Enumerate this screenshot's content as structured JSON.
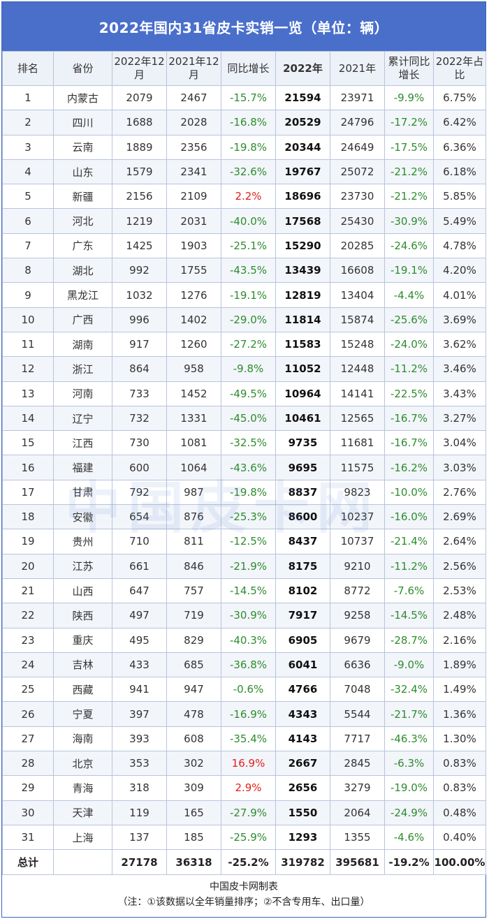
{
  "title": "2022年国内31省皮卡实销一览（单位：辆）",
  "headers": {
    "rank": "排名",
    "province": "省份",
    "dec2022": "2022年12月",
    "dec2021": "2021年12月",
    "yoy": "同比增长",
    "y2022": "2022年",
    "y2021": "2021年",
    "cum_yoy": "累计同比增长",
    "share": "2022年占比"
  },
  "colors": {
    "header_bg": "#4a6fcb",
    "positive": "#e0201c",
    "negative": "#2e8b2e"
  },
  "rows": [
    {
      "rank": "1",
      "province": "内蒙古",
      "dec2022": "2079",
      "dec2021": "2467",
      "yoy": "-15.7%",
      "y2022": "21594",
      "y2021": "23971",
      "cum_yoy": "-9.9%",
      "share": "6.75%"
    },
    {
      "rank": "2",
      "province": "四川",
      "dec2022": "1688",
      "dec2021": "2028",
      "yoy": "-16.8%",
      "y2022": "20529",
      "y2021": "24796",
      "cum_yoy": "-17.2%",
      "share": "6.42%"
    },
    {
      "rank": "3",
      "province": "云南",
      "dec2022": "1889",
      "dec2021": "2356",
      "yoy": "-19.8%",
      "y2022": "20344",
      "y2021": "24649",
      "cum_yoy": "-17.5%",
      "share": "6.36%"
    },
    {
      "rank": "4",
      "province": "山东",
      "dec2022": "1579",
      "dec2021": "2341",
      "yoy": "-32.6%",
      "y2022": "19767",
      "y2021": "25072",
      "cum_yoy": "-21.2%",
      "share": "6.18%"
    },
    {
      "rank": "5",
      "province": "新疆",
      "dec2022": "2156",
      "dec2021": "2109",
      "yoy": "2.2%",
      "y2022": "18696",
      "y2021": "23730",
      "cum_yoy": "-21.2%",
      "share": "5.85%"
    },
    {
      "rank": "6",
      "province": "河北",
      "dec2022": "1219",
      "dec2021": "2031",
      "yoy": "-40.0%",
      "y2022": "17568",
      "y2021": "25430",
      "cum_yoy": "-30.9%",
      "share": "5.49%"
    },
    {
      "rank": "7",
      "province": "广东",
      "dec2022": "1425",
      "dec2021": "1903",
      "yoy": "-25.1%",
      "y2022": "15290",
      "y2021": "20285",
      "cum_yoy": "-24.6%",
      "share": "4.78%"
    },
    {
      "rank": "8",
      "province": "湖北",
      "dec2022": "992",
      "dec2021": "1755",
      "yoy": "-43.5%",
      "y2022": "13439",
      "y2021": "16608",
      "cum_yoy": "-19.1%",
      "share": "4.20%"
    },
    {
      "rank": "9",
      "province": "黑龙江",
      "dec2022": "1032",
      "dec2021": "1276",
      "yoy": "-19.1%",
      "y2022": "12819",
      "y2021": "13404",
      "cum_yoy": "-4.4%",
      "share": "4.01%"
    },
    {
      "rank": "10",
      "province": "广西",
      "dec2022": "996",
      "dec2021": "1402",
      "yoy": "-29.0%",
      "y2022": "11814",
      "y2021": "15874",
      "cum_yoy": "-25.6%",
      "share": "3.69%"
    },
    {
      "rank": "11",
      "province": "湖南",
      "dec2022": "917",
      "dec2021": "1260",
      "yoy": "-27.2%",
      "y2022": "11583",
      "y2021": "15248",
      "cum_yoy": "-24.0%",
      "share": "3.62%"
    },
    {
      "rank": "12",
      "province": "浙江",
      "dec2022": "864",
      "dec2021": "958",
      "yoy": "-9.8%",
      "y2022": "11052",
      "y2021": "12448",
      "cum_yoy": "-11.2%",
      "share": "3.46%"
    },
    {
      "rank": "13",
      "province": "河南",
      "dec2022": "733",
      "dec2021": "1452",
      "yoy": "-49.5%",
      "y2022": "10964",
      "y2021": "14141",
      "cum_yoy": "-22.5%",
      "share": "3.43%"
    },
    {
      "rank": "14",
      "province": "辽宁",
      "dec2022": "732",
      "dec2021": "1331",
      "yoy": "-45.0%",
      "y2022": "10461",
      "y2021": "12565",
      "cum_yoy": "-16.7%",
      "share": "3.27%"
    },
    {
      "rank": "15",
      "province": "江西",
      "dec2022": "730",
      "dec2021": "1081",
      "yoy": "-32.5%",
      "y2022": "9735",
      "y2021": "11681",
      "cum_yoy": "-16.7%",
      "share": "3.04%"
    },
    {
      "rank": "16",
      "province": "福建",
      "dec2022": "600",
      "dec2021": "1064",
      "yoy": "-43.6%",
      "y2022": "9695",
      "y2021": "11575",
      "cum_yoy": "-16.2%",
      "share": "3.03%"
    },
    {
      "rank": "17",
      "province": "甘肃",
      "dec2022": "792",
      "dec2021": "987",
      "yoy": "-19.8%",
      "y2022": "8837",
      "y2021": "9823",
      "cum_yoy": "-10.0%",
      "share": "2.76%"
    },
    {
      "rank": "18",
      "province": "安徽",
      "dec2022": "654",
      "dec2021": "876",
      "yoy": "-25.3%",
      "y2022": "8600",
      "y2021": "10237",
      "cum_yoy": "-16.0%",
      "share": "2.69%"
    },
    {
      "rank": "19",
      "province": "贵州",
      "dec2022": "710",
      "dec2021": "811",
      "yoy": "-12.5%",
      "y2022": "8437",
      "y2021": "10737",
      "cum_yoy": "-21.4%",
      "share": "2.64%"
    },
    {
      "rank": "20",
      "province": "江苏",
      "dec2022": "661",
      "dec2021": "846",
      "yoy": "-21.9%",
      "y2022": "8175",
      "y2021": "9210",
      "cum_yoy": "-11.2%",
      "share": "2.56%"
    },
    {
      "rank": "21",
      "province": "山西",
      "dec2022": "647",
      "dec2021": "757",
      "yoy": "-14.5%",
      "y2022": "8102",
      "y2021": "8772",
      "cum_yoy": "-7.6%",
      "share": "2.53%"
    },
    {
      "rank": "22",
      "province": "陕西",
      "dec2022": "497",
      "dec2021": "719",
      "yoy": "-30.9%",
      "y2022": "7917",
      "y2021": "9258",
      "cum_yoy": "-14.5%",
      "share": "2.48%"
    },
    {
      "rank": "23",
      "province": "重庆",
      "dec2022": "495",
      "dec2021": "829",
      "yoy": "-40.3%",
      "y2022": "6905",
      "y2021": "9679",
      "cum_yoy": "-28.7%",
      "share": "2.16%"
    },
    {
      "rank": "24",
      "province": "吉林",
      "dec2022": "433",
      "dec2021": "685",
      "yoy": "-36.8%",
      "y2022": "6041",
      "y2021": "6636",
      "cum_yoy": "-9.0%",
      "share": "1.89%"
    },
    {
      "rank": "25",
      "province": "西藏",
      "dec2022": "941",
      "dec2021": "947",
      "yoy": "-0.6%",
      "y2022": "4766",
      "y2021": "7048",
      "cum_yoy": "-32.4%",
      "share": "1.49%"
    },
    {
      "rank": "26",
      "province": "宁夏",
      "dec2022": "397",
      "dec2021": "478",
      "yoy": "-16.9%",
      "y2022": "4343",
      "y2021": "5544",
      "cum_yoy": "-21.7%",
      "share": "1.36%"
    },
    {
      "rank": "27",
      "province": "海南",
      "dec2022": "393",
      "dec2021": "608",
      "yoy": "-35.4%",
      "y2022": "4143",
      "y2021": "7717",
      "cum_yoy": "-46.3%",
      "share": "1.30%"
    },
    {
      "rank": "28",
      "province": "北京",
      "dec2022": "353",
      "dec2021": "302",
      "yoy": "16.9%",
      "y2022": "2667",
      "y2021": "2845",
      "cum_yoy": "-6.3%",
      "share": "0.83%"
    },
    {
      "rank": "29",
      "province": "青海",
      "dec2022": "318",
      "dec2021": "309",
      "yoy": "2.9%",
      "y2022": "2656",
      "y2021": "3279",
      "cum_yoy": "-19.0%",
      "share": "0.83%"
    },
    {
      "rank": "30",
      "province": "天津",
      "dec2022": "119",
      "dec2021": "165",
      "yoy": "-27.9%",
      "y2022": "1550",
      "y2021": "2064",
      "cum_yoy": "-24.9%",
      "share": "0.48%"
    },
    {
      "rank": "31",
      "province": "上海",
      "dec2022": "137",
      "dec2021": "185",
      "yoy": "-25.9%",
      "y2022": "1293",
      "y2021": "1355",
      "cum_yoy": "-4.6%",
      "share": "0.40%"
    }
  ],
  "total": {
    "label": "总计",
    "dec2022": "27178",
    "dec2021": "36318",
    "yoy": "-25.2%",
    "y2022": "319782",
    "y2021": "395681",
    "cum_yoy": "-19.2%",
    "share": "100.00%"
  },
  "footer": {
    "maker": "中国皮卡网制表",
    "note": "（注：①该数据以全年销量排序；②不含专用车、出口量）"
  },
  "watermark": "中国皮卡网"
}
